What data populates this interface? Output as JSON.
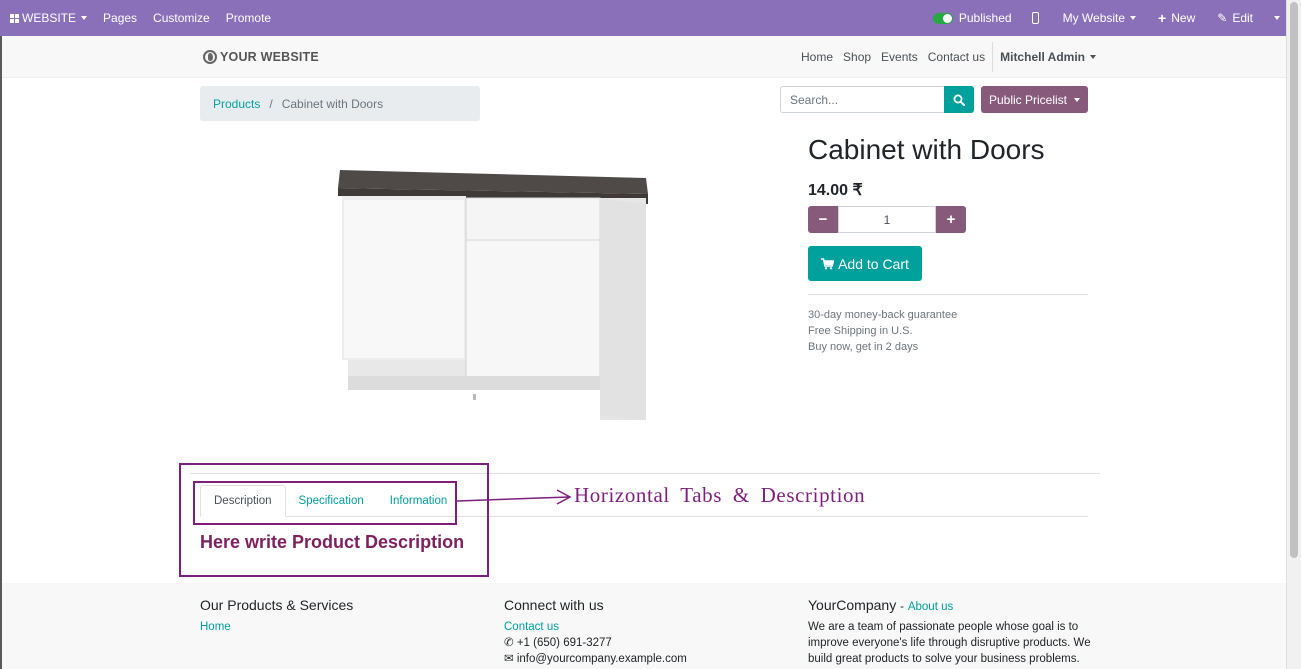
{
  "adminbar": {
    "website_label": "WEBSITE",
    "pages_label": "Pages",
    "customize_label": "Customize",
    "promote_label": "Promote",
    "published_label": "Published",
    "my_website_label": "My Website",
    "new_label": "New",
    "edit_label": "Edit",
    "bar_color": "#8a70b8"
  },
  "header": {
    "logo_text": "YOUR WEBSITE",
    "nav": [
      "Home",
      "Shop",
      "Events",
      "Contact us"
    ],
    "user": "Mitchell Admin"
  },
  "breadcrumb": {
    "parent": "Products",
    "separator": "/",
    "current": "Cabinet with Doors"
  },
  "search": {
    "placeholder": "Search...",
    "pricelist_label": "Public Pricelist"
  },
  "product": {
    "title": "Cabinet with Doors",
    "price": "14.00 ₹",
    "quantity": "1",
    "add_to_cart_label": "Add to Cart",
    "guarantees": [
      "30-day money-back guarantee",
      "Free Shipping in U.S.",
      "Buy now, get in 2 days"
    ]
  },
  "tabs": {
    "items": [
      "Description",
      "Specification",
      "Information"
    ],
    "active": "Description",
    "description": "Here write Product Description"
  },
  "annotation": {
    "text": "Horizontal Tabs & Description",
    "color": "#7e1f7e"
  },
  "footer": {
    "col1": {
      "title": "Our Products & Services",
      "link": "Home"
    },
    "col2": {
      "title": "Connect with us",
      "link": "Contact us",
      "phone": "+1 (650) 691-3277",
      "email": "info@yourcompany.example.com"
    },
    "col3": {
      "title": "YourCompany",
      "dash": "-",
      "about": "About us",
      "text": "We are a team of passionate people whose goal is to improve everyone's life through disruptive products. We build great products to solve your business problems."
    }
  },
  "colors": {
    "primary": "#00a09d",
    "secondary": "#875a7b"
  }
}
